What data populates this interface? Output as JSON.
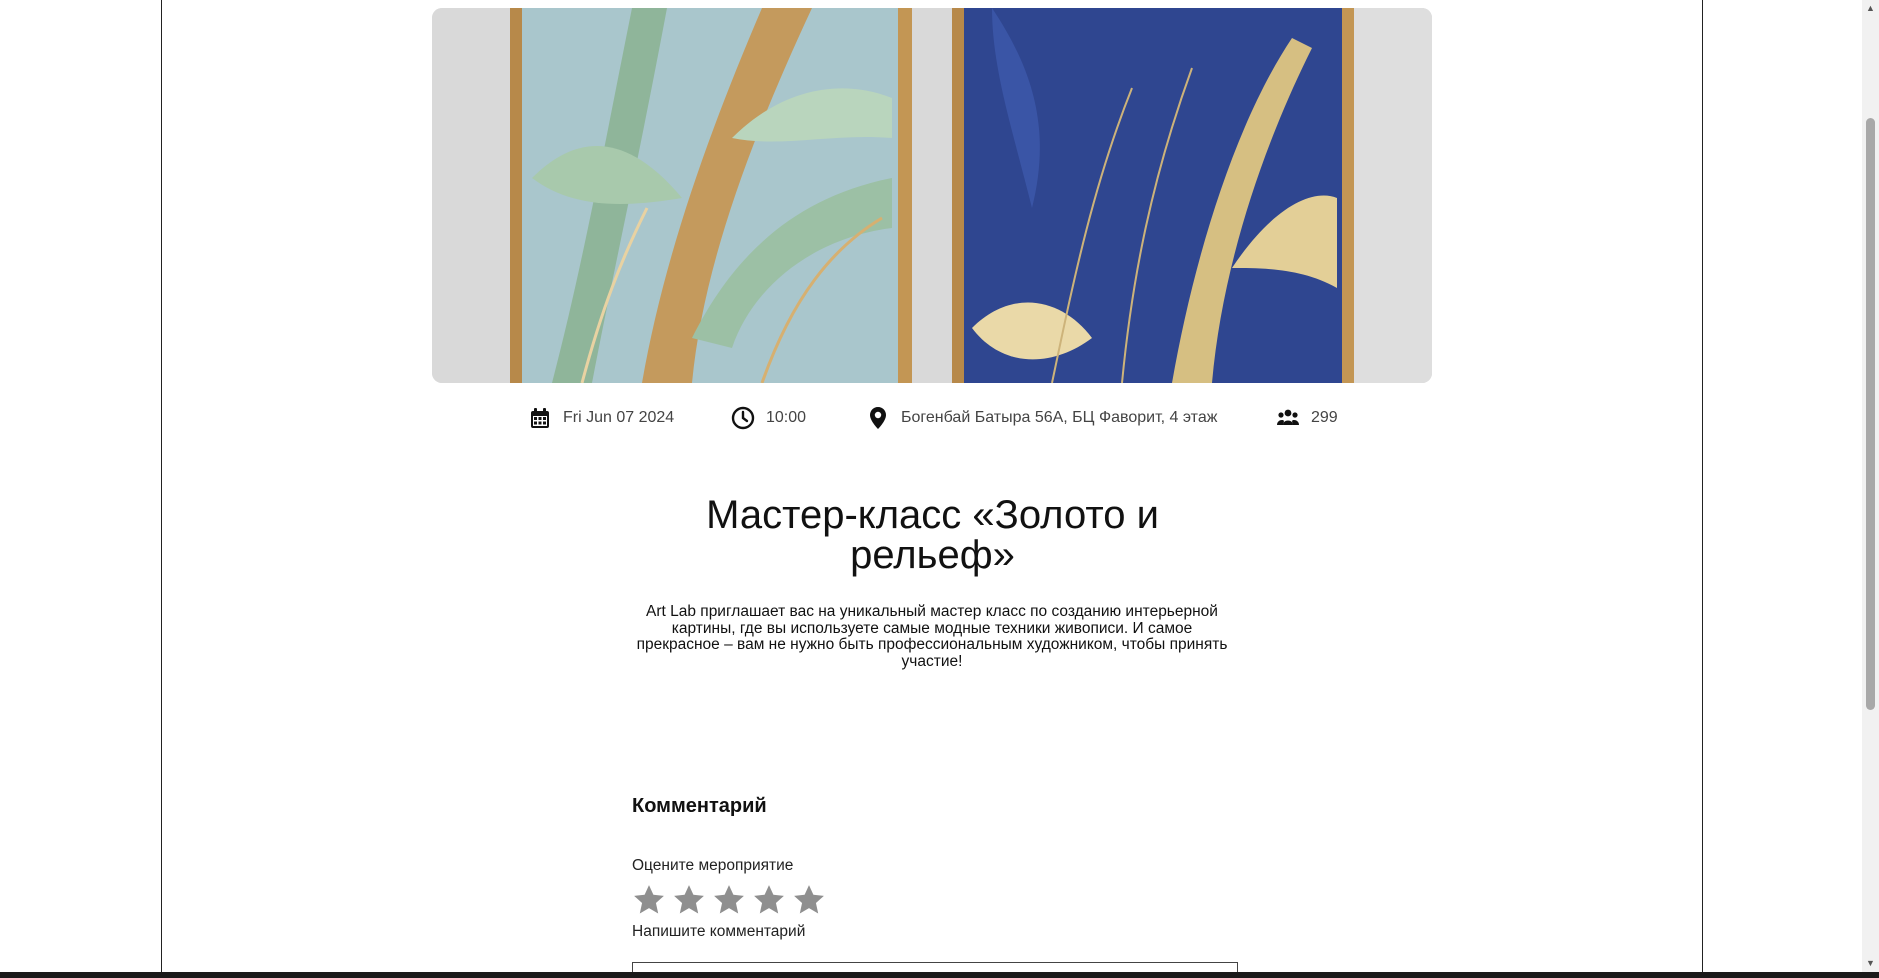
{
  "event": {
    "image_alt": "Две интерьерные картины с листьями в золотом рельефе",
    "date": "Fri Jun 07 2024",
    "time": "10:00",
    "location": "Богенбай Батыра 56А, БЦ Фаворит, 4 этаж",
    "attendees": "299",
    "title": "Мастер-класс «Золото и рельеф»",
    "description": "Art Lab приглашает вас на уникальный мастер класс по созданию интерьерной картины, где вы используете самые модные техники живописи. И самое прекрасное – вам не нужно быть профессиональным художником, чтобы принять участие!"
  },
  "icons": {
    "date": "calendar-icon",
    "time": "clock-icon",
    "location": "map-pin-icon",
    "attendees": "users-icon"
  },
  "comments": {
    "heading": "Комментарий",
    "rate_label": "Оцените мероприятие",
    "rating": {
      "value": 0,
      "max": 5
    },
    "write_label": "Напишите комментарий",
    "comment_value": "",
    "comment_placeholder": ""
  },
  "colors": {
    "star_inactive": "#8f8f8f",
    "icon": "#111111",
    "meta_text": "#444444"
  }
}
